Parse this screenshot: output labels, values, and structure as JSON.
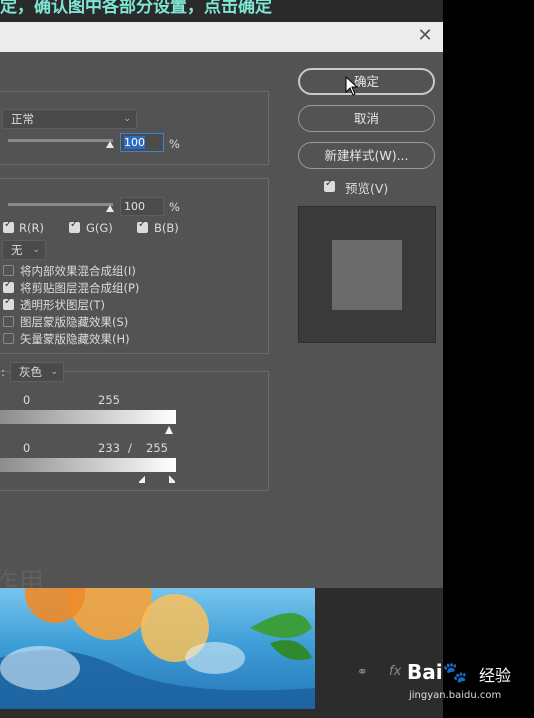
{
  "caption": "定，确认图中各部分设置，点击确定",
  "dialog": {
    "close_icon": "close-icon",
    "general": {
      "blend_mode": "正常",
      "opacity_value": "100",
      "opacity_unit": "%"
    },
    "advanced": {
      "fill_opacity_value": "100",
      "fill_opacity_unit": "%",
      "channels": [
        {
          "label": "R(R)",
          "checked": true
        },
        {
          "label": "G(G)",
          "checked": true
        },
        {
          "label": "B(B)",
          "checked": true
        }
      ],
      "knockout": "无",
      "options": [
        {
          "label": "将内部效果混合成组(I)",
          "checked": false
        },
        {
          "label": "将剪贴图层混合成组(P)",
          "checked": true
        },
        {
          "label": "透明形状图层(T)",
          "checked": true
        },
        {
          "label": "图层蒙版隐藏效果(S)",
          "checked": false
        },
        {
          "label": "矢量蒙版隐藏效果(H)",
          "checked": false
        }
      ]
    },
    "blend_if": {
      "prefix": ":",
      "channel": "灰色",
      "this_layer": {
        "low": "0",
        "high": "255"
      },
      "underlying_layer": {
        "low": "0",
        "high_a": "233",
        "sep": "/",
        "high_b": "255"
      }
    },
    "buttons": {
      "ok": "确定",
      "cancel": "取消",
      "new_style": "新建样式(W)..."
    },
    "preview": {
      "label": "预览(V)",
      "checked": true
    },
    "ghost_text": "作用"
  },
  "watermark": {
    "brand": "Bai",
    "brand2": "经验",
    "url": "jingyan.baidu.com"
  },
  "colors": {
    "dialog_bg": "#535353",
    "accent": "#2d6bc5",
    "caption": "#7fe6d4"
  }
}
